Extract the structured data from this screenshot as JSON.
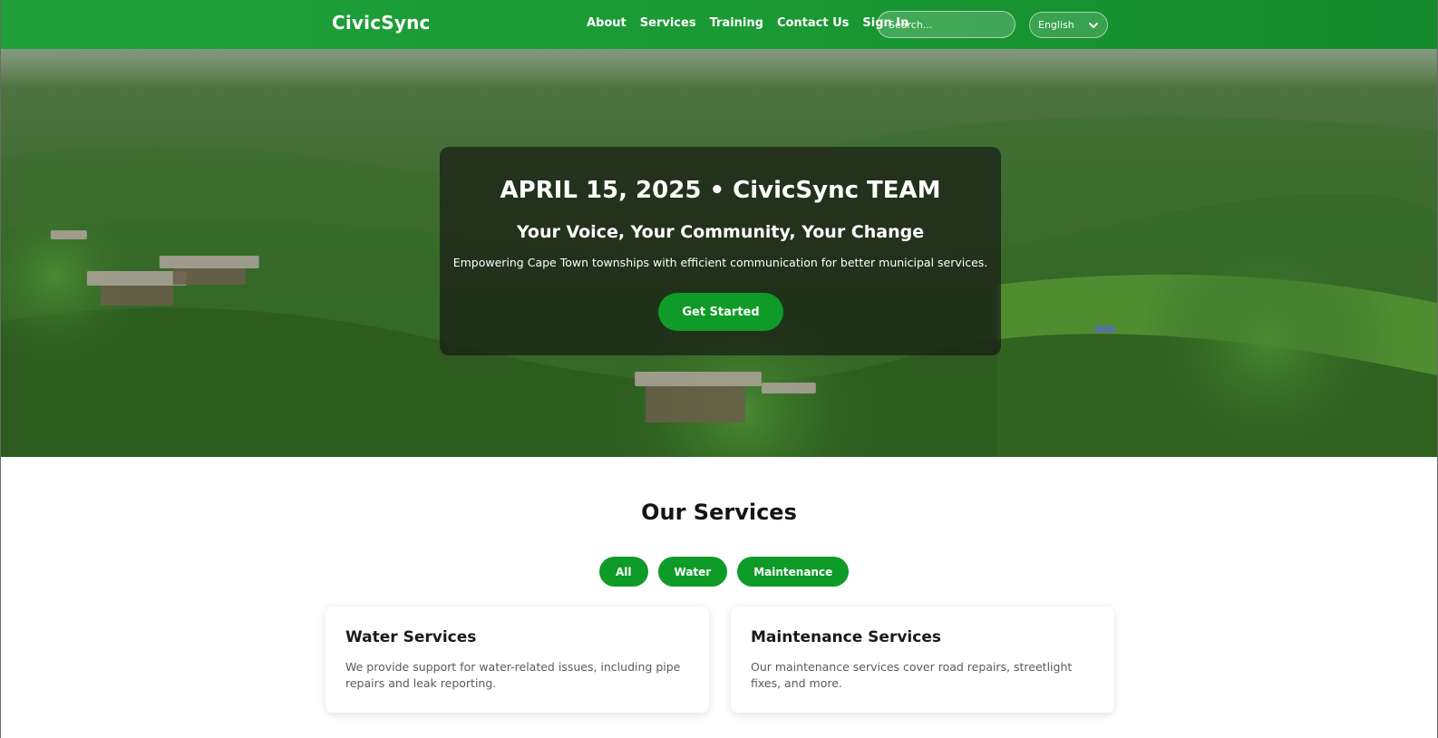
{
  "navbar": {
    "brand": "CivicSync",
    "links": [
      "About",
      "Services",
      "Training",
      "Contact Us",
      "Sign In"
    ],
    "search_placeholder": "Search...",
    "language": "English"
  },
  "hero": {
    "title": "APRIL 15, 2025 • CivicSync TEAM",
    "subtitle": "Your Voice, Your Community, Your Change",
    "description": "Empowering Cape Town townships with efficient communication for better municipal services.",
    "cta_label": "Get Started",
    "carousel": {
      "slide_count": 9,
      "active_index": 1
    }
  },
  "services": {
    "title": "Our Services",
    "filters": [
      "All",
      "Water",
      "Maintenance"
    ],
    "cards": [
      {
        "title": "Water Services",
        "text": "We provide support for water-related issues, including pipe repairs and leak reporting."
      },
      {
        "title": "Maintenance Services",
        "text": "Our maintenance services cover road repairs, streetlight fixes, and more."
      }
    ]
  },
  "colors": {
    "brand_green": "#1a9a34",
    "button_green": "#0f9b28",
    "overlay": "#191c16"
  }
}
